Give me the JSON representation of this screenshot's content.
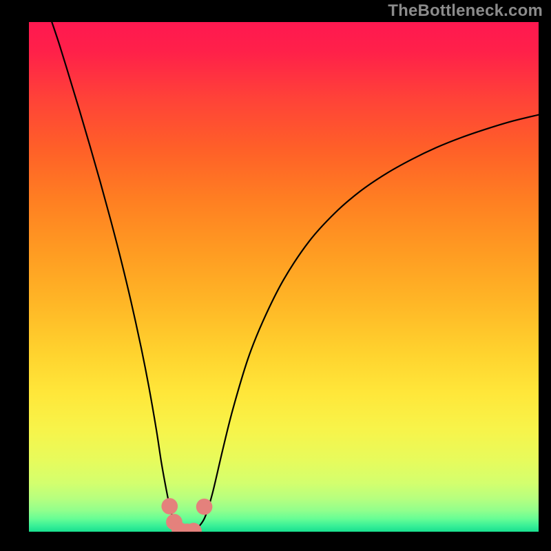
{
  "watermark": "TheBottleneck.com",
  "chart_data": {
    "type": "line",
    "title": "",
    "xlabel": "",
    "ylabel": "",
    "xlim": [
      0,
      100
    ],
    "ylim": [
      0,
      100
    ],
    "grid": false,
    "legend": false,
    "annotations": [],
    "background_gradient": {
      "stops": [
        {
          "offset": 0.0,
          "color": "#ff1850"
        },
        {
          "offset": 0.06,
          "color": "#ff2149"
        },
        {
          "offset": 0.15,
          "color": "#ff4238"
        },
        {
          "offset": 0.25,
          "color": "#ff6028"
        },
        {
          "offset": 0.35,
          "color": "#ff7f22"
        },
        {
          "offset": 0.45,
          "color": "#ff9b22"
        },
        {
          "offset": 0.55,
          "color": "#ffb626"
        },
        {
          "offset": 0.65,
          "color": "#ffd32e"
        },
        {
          "offset": 0.73,
          "color": "#ffe73a"
        },
        {
          "offset": 0.8,
          "color": "#f7f44a"
        },
        {
          "offset": 0.86,
          "color": "#e7fb5c"
        },
        {
          "offset": 0.905,
          "color": "#d3ff6e"
        },
        {
          "offset": 0.935,
          "color": "#b6ff7f"
        },
        {
          "offset": 0.958,
          "color": "#92ff8c"
        },
        {
          "offset": 0.975,
          "color": "#66fd95"
        },
        {
          "offset": 0.988,
          "color": "#3af097"
        },
        {
          "offset": 1.0,
          "color": "#18e08f"
        }
      ]
    },
    "series": [
      {
        "name": "bottleneck-curve",
        "color": "#000000",
        "x": [
          4.5,
          6,
          8,
          10,
          12,
          14,
          16,
          18,
          20,
          22,
          23.5,
          25,
          26,
          27,
          27.8,
          28.6,
          29.5,
          30.5,
          31.5,
          32.5,
          33.5,
          34.6,
          36,
          38,
          40,
          43,
          46,
          50,
          55,
          60,
          65,
          70,
          75,
          80,
          85,
          90,
          95,
          100
        ],
        "y": [
          100,
          95.5,
          89,
          82.4,
          75.6,
          68.6,
          61.3,
          53.6,
          45.3,
          36.2,
          28.6,
          20,
          13.5,
          8,
          4.2,
          1.8,
          0.5,
          0,
          0,
          0.3,
          1.2,
          3,
          7.5,
          16,
          24,
          34,
          41.5,
          49.5,
          57,
          62.5,
          66.8,
          70.2,
          73,
          75.4,
          77.4,
          79.1,
          80.6,
          81.8
        ]
      }
    ],
    "markers": [
      {
        "name": "marker-left-upper",
        "x": 27.6,
        "y": 5.0,
        "r": 1.6,
        "color": "#e4817c"
      },
      {
        "name": "marker-left-mid",
        "x": 28.5,
        "y": 1.9,
        "r": 1.6,
        "color": "#e4817c"
      },
      {
        "name": "marker-bottom-left",
        "x": 29.6,
        "y": 0.25,
        "r": 1.6,
        "color": "#e4817c"
      },
      {
        "name": "marker-bottom-mid",
        "x": 31.0,
        "y": 0.0,
        "r": 1.6,
        "color": "#e4817c"
      },
      {
        "name": "marker-bottom-right",
        "x": 32.3,
        "y": 0.15,
        "r": 1.6,
        "color": "#e4817c"
      },
      {
        "name": "marker-right-upper",
        "x": 34.4,
        "y": 4.9,
        "r": 1.6,
        "color": "#e4817c"
      }
    ]
  }
}
